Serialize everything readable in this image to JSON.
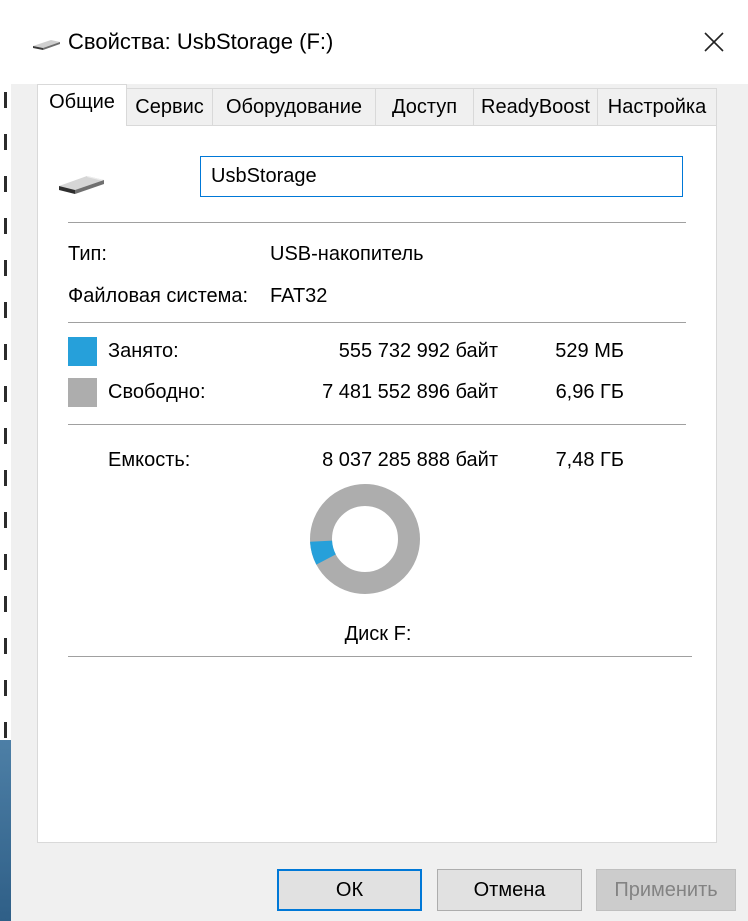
{
  "window": {
    "title": "Свойства: UsbStorage (F:)"
  },
  "tabs": [
    {
      "label": "Общие",
      "active": true
    },
    {
      "label": "Сервис",
      "active": false
    },
    {
      "label": "Оборудование",
      "active": false
    },
    {
      "label": "Доступ",
      "active": false
    },
    {
      "label": "ReadyBoost",
      "active": false
    },
    {
      "label": "Настройка",
      "active": false
    }
  ],
  "general": {
    "volume_name": "UsbStorage",
    "type_label": "Тип:",
    "type_value": "USB-накопитель",
    "fs_label": "Файловая система:",
    "fs_value": "FAT32",
    "used": {
      "label": "Занято:",
      "bytes": "555 732 992 байт",
      "human": "529 МБ",
      "color": "#26a0da"
    },
    "free": {
      "label": "Свободно:",
      "bytes": "7 481 552 896 байт",
      "human": "6,96 ГБ",
      "color": "#adadad"
    },
    "capacity": {
      "label": "Емкость:",
      "bytes": "8 037 285 888 байт",
      "human": "7,48 ГБ"
    },
    "used_fraction": 0.0691,
    "disk_label": "Диск F:"
  },
  "buttons": {
    "ok": "ОК",
    "cancel": "Отмена",
    "apply": "Применить"
  },
  "icons": {
    "title": "usb-drive-icon",
    "close": "close-icon",
    "drive": "usb-drive-icon"
  }
}
